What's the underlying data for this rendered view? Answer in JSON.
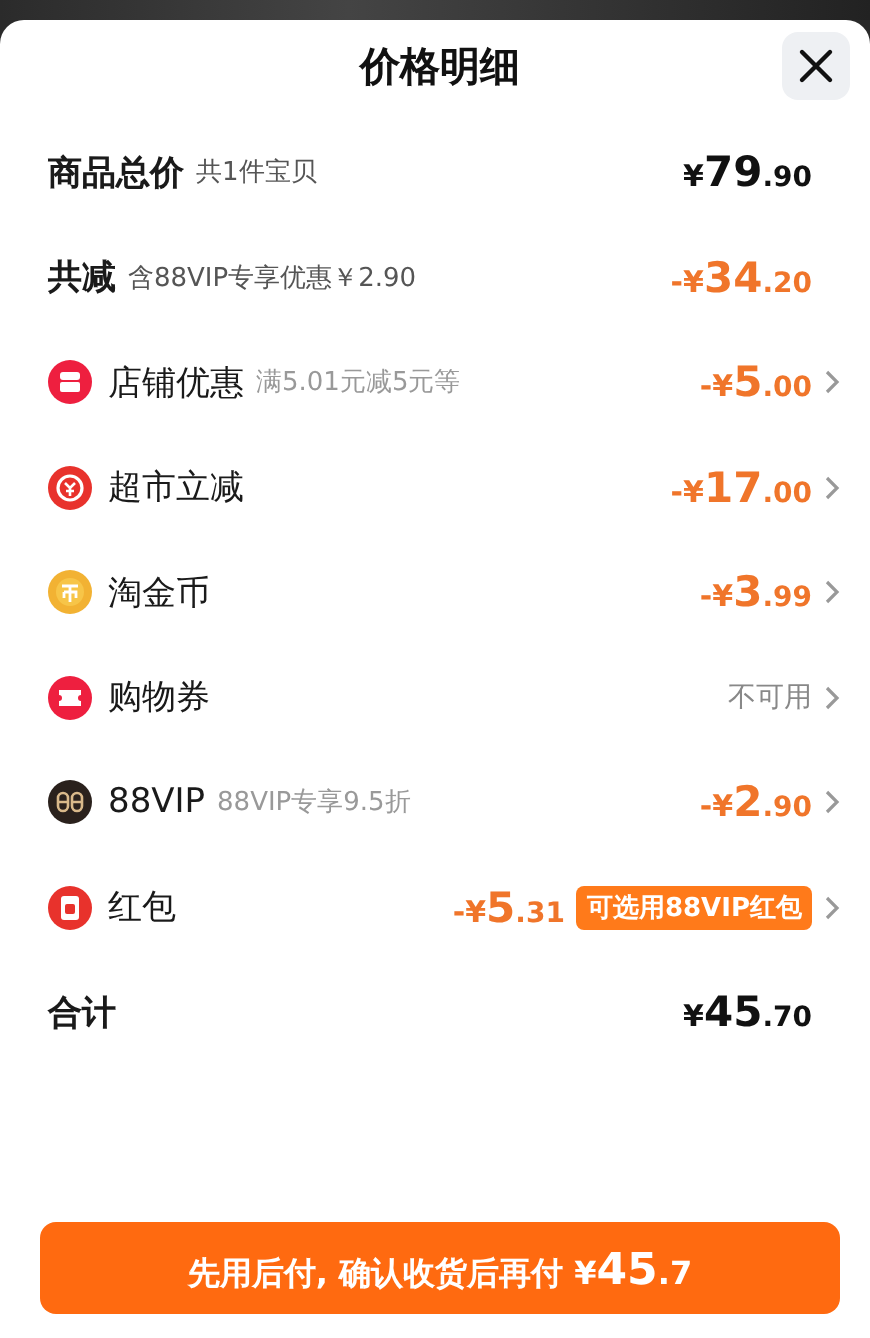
{
  "title": "价格明细",
  "rows": [
    {
      "kind": "summary",
      "label": "商品总价",
      "note": "共1件宝贝",
      "amount": "¥79.90",
      "discount": false,
      "arrow": false
    },
    {
      "kind": "summary",
      "label": "共减",
      "note": "含88VIP专享优惠￥2.90",
      "amount": "-¥34.20",
      "discount": true,
      "arrow": false
    },
    {
      "kind": "item",
      "label": "店铺优惠",
      "note": "满5.01元减5元等",
      "amount": "-¥5.00",
      "discount": true,
      "arrow": true
    },
    {
      "kind": "item",
      "label": "超市立减",
      "amount": "-¥17.00",
      "discount": true,
      "arrow": true
    },
    {
      "kind": "item",
      "label": "淘金币",
      "amount": "-¥3.99",
      "discount": true,
      "arrow": true
    },
    {
      "kind": "item",
      "label": "购物券",
      "status": "不可用",
      "arrow": true
    },
    {
      "kind": "item",
      "label": "88VIP",
      "note": "88VIP专享9.5折",
      "amount": "-¥2.90",
      "discount": true,
      "arrow": true
    },
    {
      "kind": "item",
      "label": "红包",
      "amount": "-¥5.31",
      "discount": true,
      "badge": "可选用88VIP红包",
      "arrow": true
    },
    {
      "kind": "summary",
      "label": "合计",
      "amount": "¥45.70",
      "discount": false,
      "arrow": false
    }
  ],
  "button": {
    "text": "先用后付, 确认收货后再付",
    "prefix": "¥",
    "amount": "45",
    "fraction": ".7"
  }
}
